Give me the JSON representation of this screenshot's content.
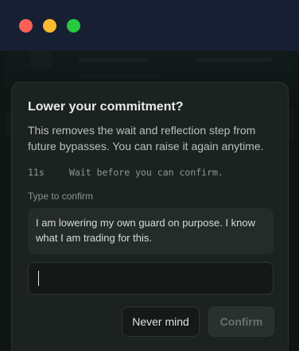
{
  "window": {
    "controls": [
      "close",
      "minimize",
      "maximize"
    ]
  },
  "dialog": {
    "title": "Lower your commitment?",
    "description": "This removes the wait and reflection step from future bypasses. You can raise it again anytime.",
    "timer": {
      "count": "11s",
      "message": "Wait before you can confirm."
    },
    "confirm_label": "Type to confirm",
    "confirm_phrase": "I am lowering my own guard on purpose. I know what I am trading for this.",
    "input": {
      "value": "",
      "placeholder": ""
    },
    "buttons": {
      "cancel": "Never mind",
      "confirm": "Confirm",
      "confirm_disabled": true
    }
  },
  "colors": {
    "titlebar": "#172033",
    "modal_bg": "#1c2220",
    "close": "#fe5f57",
    "minimize": "#febc2e",
    "maximize": "#28c840"
  }
}
